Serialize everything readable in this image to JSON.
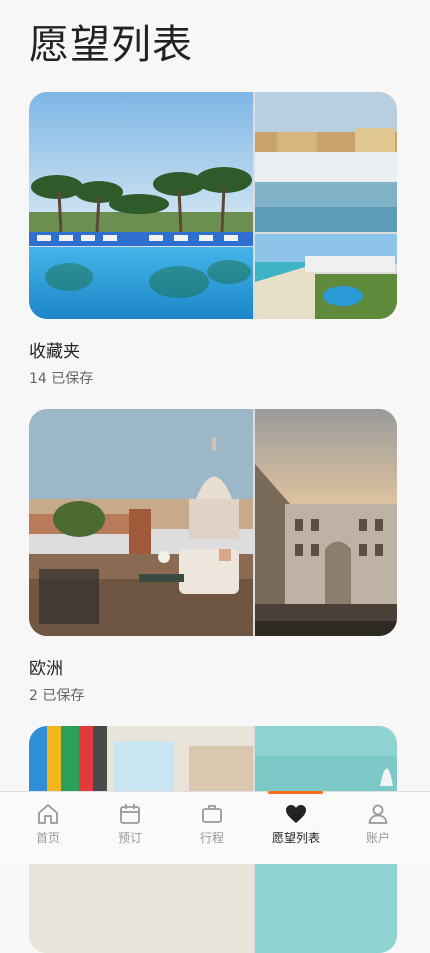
{
  "header": {
    "title": "愿望列表"
  },
  "collections": [
    {
      "title": "收藏夹",
      "count": "14 已保存"
    },
    {
      "title": "欧洲",
      "count": "2 已保存"
    },
    {
      "title": "",
      "count": ""
    }
  ],
  "tabs": [
    {
      "label": "首页",
      "icon": "home-icon"
    },
    {
      "label": "预订",
      "icon": "calendar-icon"
    },
    {
      "label": "行程",
      "icon": "suitcase-icon"
    },
    {
      "label": "愿望列表",
      "icon": "heart-icon",
      "active": true
    },
    {
      "label": "账户",
      "icon": "person-icon"
    }
  ],
  "colors": {
    "accent": "#ff6a1f",
    "text": "#222222",
    "muted": "#999999"
  }
}
